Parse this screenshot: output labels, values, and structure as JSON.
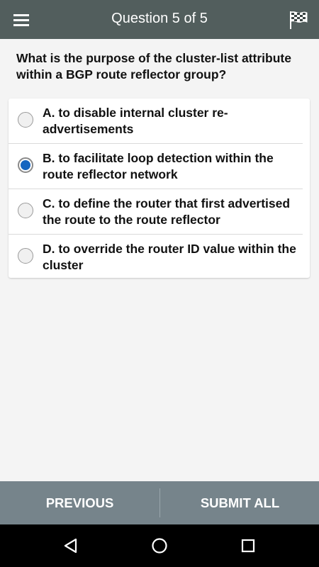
{
  "appbar": {
    "title": "Question 5 of 5",
    "menu_icon": "hamburger-menu-icon",
    "flag_icon": "checkered-flag-icon"
  },
  "question": {
    "text": "What is the purpose of the cluster-list attribute within a BGP route reflector group?"
  },
  "options": [
    {
      "label": "A. to disable internal cluster re-advertisements",
      "selected": false
    },
    {
      "label": "B. to facilitate loop detection within the route reflector network",
      "selected": true
    },
    {
      "label": "C. to define the router that first advertised the route to the route reflector",
      "selected": false
    },
    {
      "label": "D. to override the router ID value within the cluster",
      "selected": false
    }
  ],
  "actions": {
    "previous_label": "PREVIOUS",
    "submit_label": "SUBMIT ALL"
  },
  "navbar": {
    "back_icon": "back-triangle-icon",
    "home_icon": "home-circle-icon",
    "recents_icon": "recents-square-icon"
  },
  "colors": {
    "appbar": "#525e5d",
    "actionbar": "#76848b",
    "radio_selected": "#1565c0",
    "background": "#f4f4f4"
  }
}
